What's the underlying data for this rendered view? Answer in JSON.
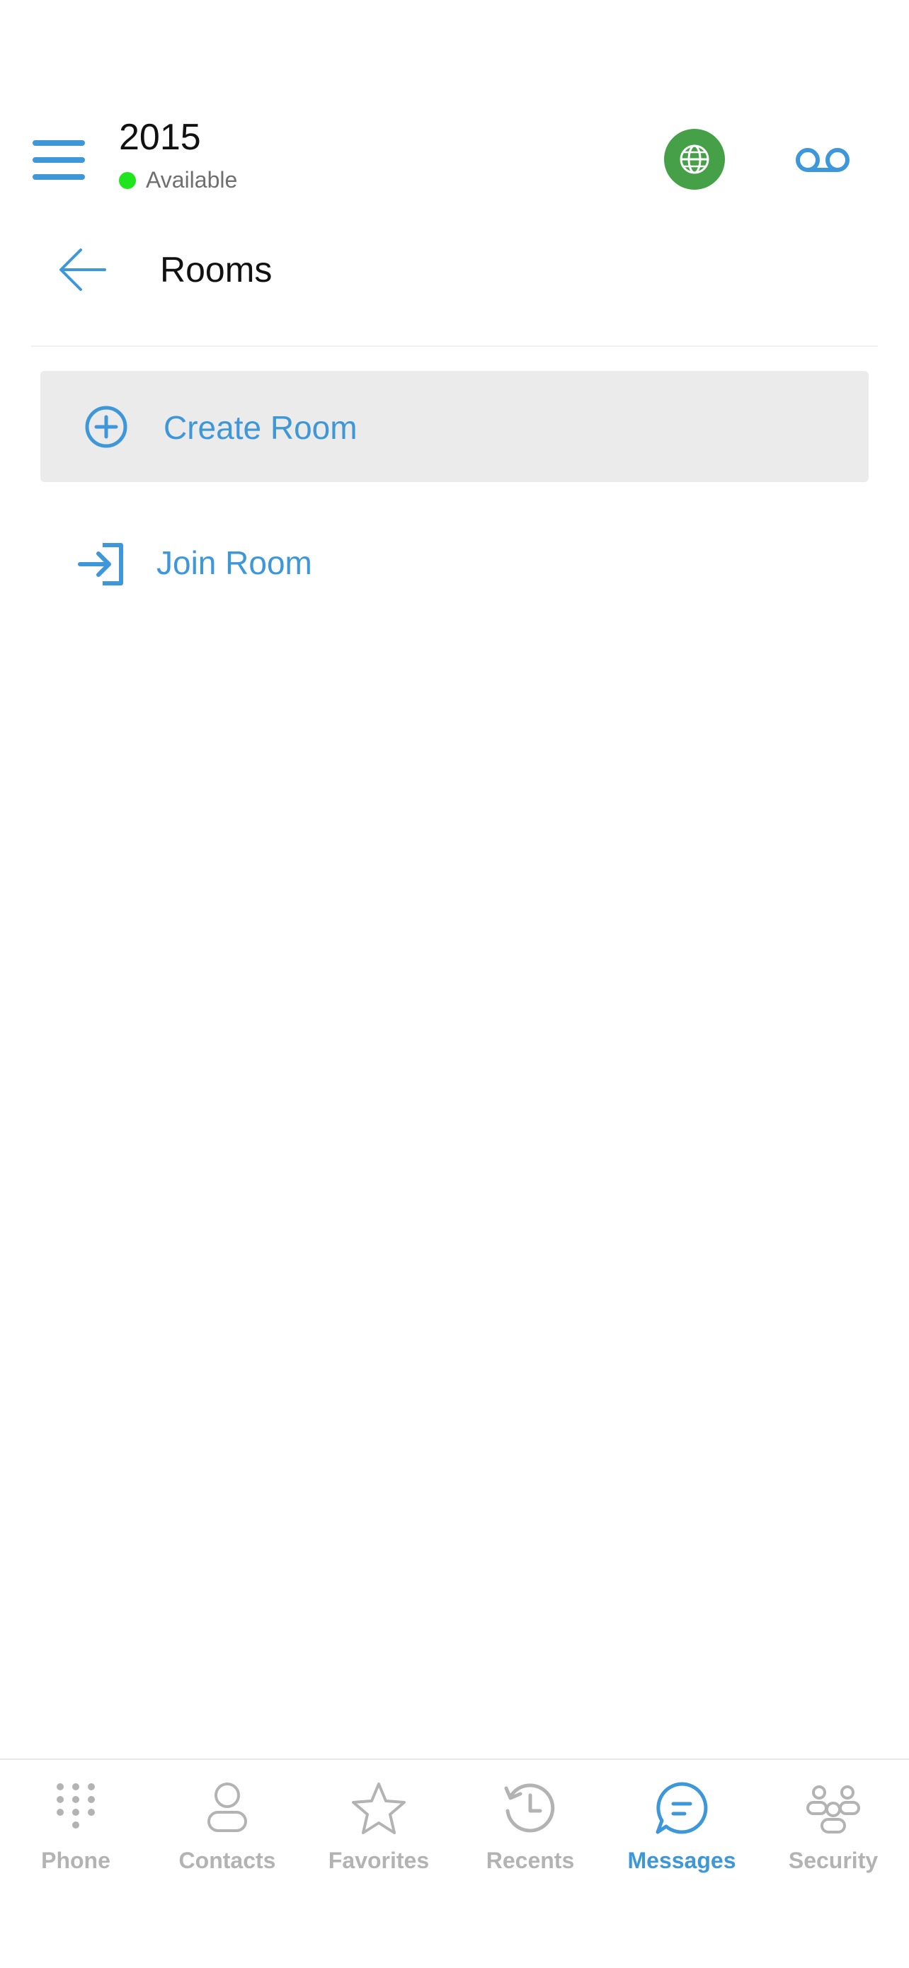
{
  "header": {
    "extension": "2015",
    "status": "Available",
    "status_color": "#1ee51e",
    "globe_icon": "globe-icon",
    "voicemail_icon": "voicemail-icon",
    "menu_icon": "hamburger-menu-icon"
  },
  "page": {
    "title": "Rooms",
    "back_icon": "arrow-left-icon"
  },
  "actions": {
    "create_room": "Create Room",
    "join_room": "Join Room"
  },
  "nav": {
    "items": [
      {
        "label": "Phone",
        "icon": "dialpad-icon"
      },
      {
        "label": "Contacts",
        "icon": "contact-icon"
      },
      {
        "label": "Favorites",
        "icon": "star-icon"
      },
      {
        "label": "Recents",
        "icon": "history-icon"
      },
      {
        "label": "Messages",
        "icon": "chat-bubble-icon",
        "active": true
      },
      {
        "label": "Security",
        "icon": "group-icon"
      }
    ]
  },
  "colors": {
    "accent": "#3d97d8",
    "globe_bg": "#45a047",
    "inactive": "#b3b3b3",
    "highlight_bg": "#ebebeb"
  }
}
